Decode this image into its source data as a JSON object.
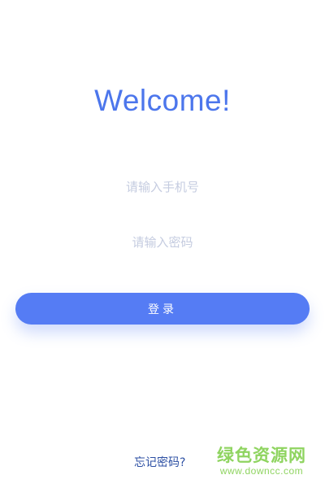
{
  "welcome": {
    "title": "Welcome!"
  },
  "form": {
    "phone_placeholder": "请输入手机号",
    "password_placeholder": "请输入密码",
    "login_label": "登录"
  },
  "footer": {
    "forgot_label": "忘记密码?"
  },
  "watermark": {
    "title": "绿色资源网",
    "url": "www.downcc.com"
  },
  "colors": {
    "accent": "#4c76ec",
    "button": "#557cf4",
    "placeholder": "#c5cce0",
    "link": "#2c4fa3",
    "watermark": "#8fd460"
  }
}
